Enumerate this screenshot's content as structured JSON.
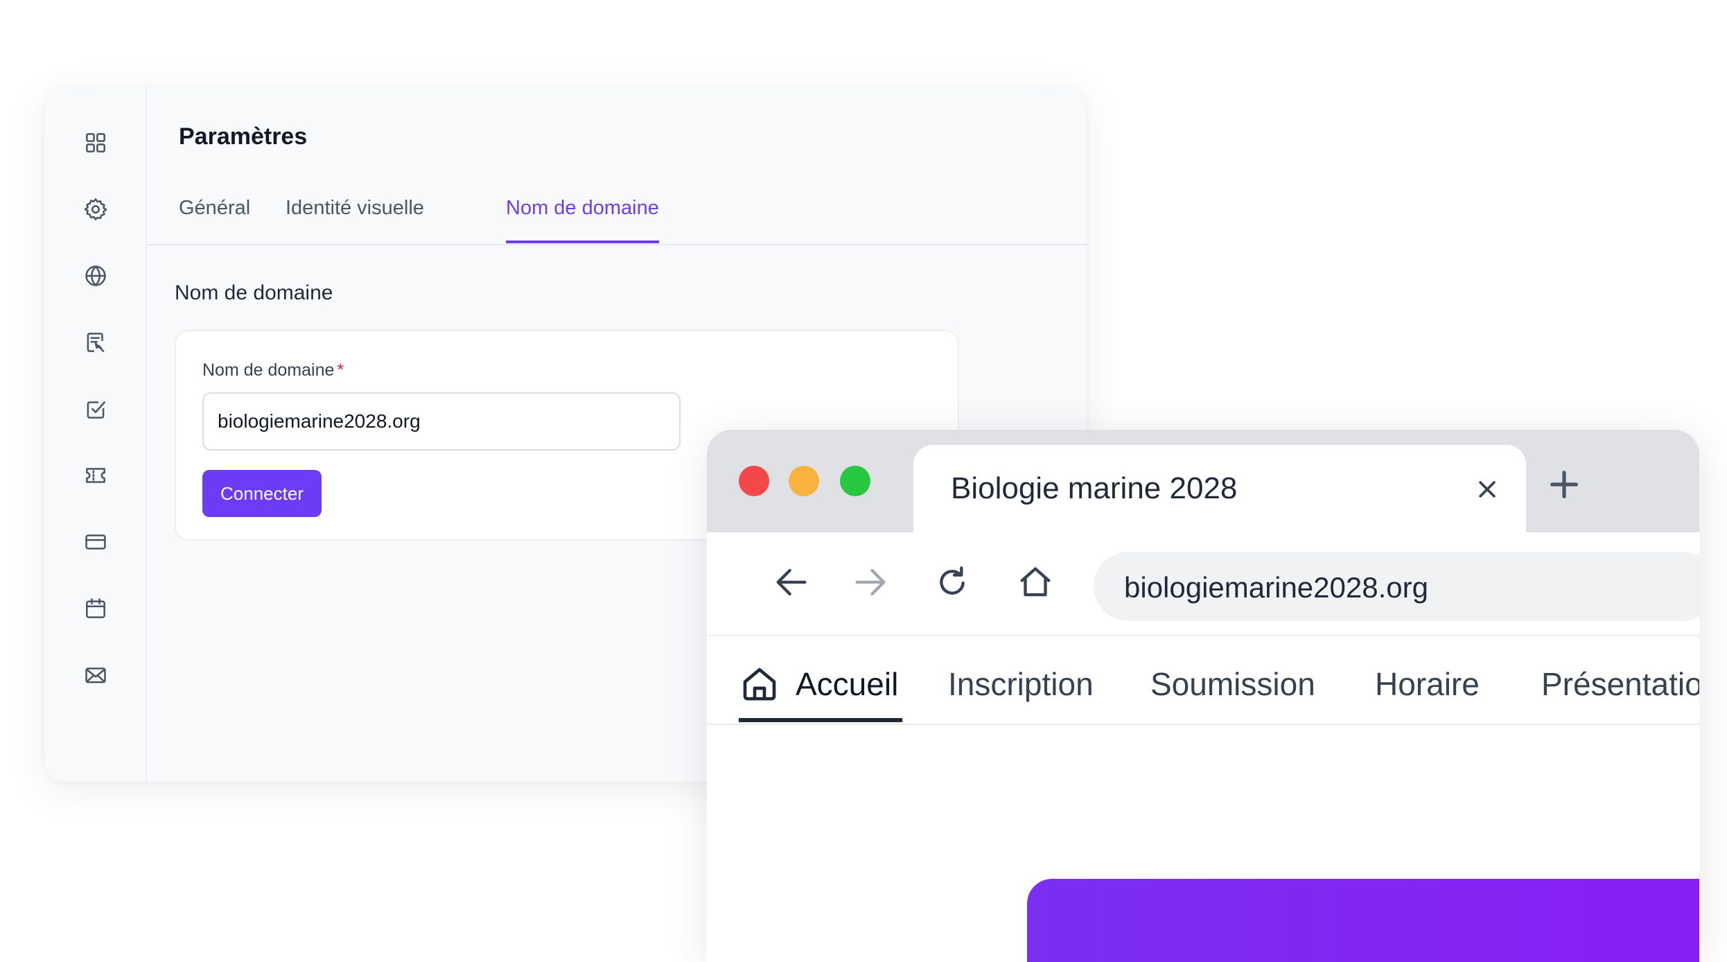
{
  "admin": {
    "title": "Paramètres",
    "sidebar_icons": [
      "grid-icon",
      "gear-icon",
      "globe-icon",
      "form-edit-icon",
      "checkbox-icon",
      "ticket-icon",
      "credit-card-icon",
      "calendar-icon",
      "mail-icon"
    ],
    "tabs": [
      {
        "label": "Général",
        "active": false
      },
      {
        "label": "Identité visuelle",
        "active": false
      },
      {
        "label": "Nom de domaine",
        "active": true
      }
    ],
    "section_title": "Nom de domaine",
    "form": {
      "label": "Nom de domaine",
      "required_mark": "*",
      "value": "biologiemarine2028.org",
      "button_label": "Connecter"
    }
  },
  "browser": {
    "tab_title": "Biologie marine 2028",
    "url": "biologiemarine2028.org",
    "site_nav": [
      {
        "label": "Accueil",
        "active": true
      },
      {
        "label": "Inscription",
        "active": false
      },
      {
        "label": "Soumission",
        "active": false
      },
      {
        "label": "Horaire",
        "active": false
      },
      {
        "label": "Présentation",
        "active": false
      }
    ]
  },
  "colors": {
    "accent": "#6b3cf4",
    "required": "#e11d48",
    "traffic_red": "#f4474a",
    "traffic_yellow": "#f9b33d",
    "traffic_green": "#27c840",
    "hero_gradient_start": "#7b2ff0",
    "hero_gradient_end": "#8a1cf7"
  }
}
